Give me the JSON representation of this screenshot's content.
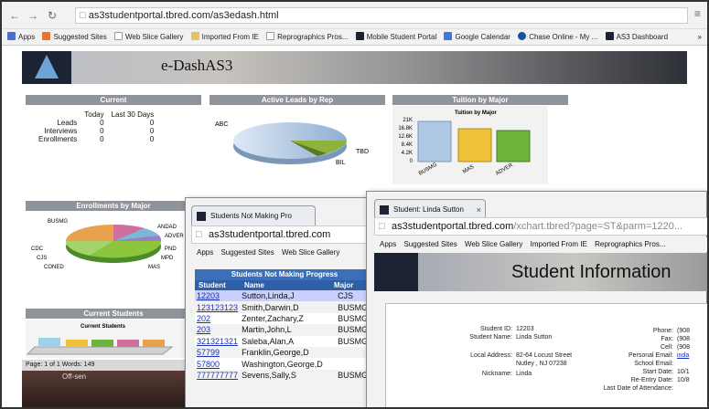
{
  "browser": {
    "url": "as3studentportal.tbred.com/as3edash.html",
    "bookmarks": [
      "Apps",
      "Suggested Sites",
      "Web Slice Gallery",
      "Imported From IE",
      "Reprographics Pros...",
      "Mobile Student Portal",
      "Google Calendar",
      "Chase Online - My ...",
      "AS3 Dashboard"
    ]
  },
  "dashboard": {
    "title": "e-DashAS3",
    "current": {
      "heading": "Current",
      "col_today": "Today",
      "col_30": "Last 30 Days",
      "rows": [
        {
          "label": "Leads",
          "today": "0",
          "last30": "0"
        },
        {
          "label": "Interviews",
          "today": "0",
          "last30": "0"
        },
        {
          "label": "Enrollments",
          "today": "0",
          "last30": "0"
        }
      ]
    },
    "active_leads": {
      "heading": "Active Leads by Rep",
      "labels": [
        "ABC",
        "TBD",
        "BIL"
      ]
    },
    "tuition": {
      "heading": "Tuition by Major",
      "chart_title": "Tuition by Major",
      "yticks": [
        "21K",
        "16.8K",
        "12.6K",
        "8.4K",
        "4.2K",
        "0"
      ],
      "categories": [
        "BUSMG",
        "MAS",
        "ADVER"
      ]
    },
    "enrollments": {
      "heading": "Enrollments by Major",
      "labels": [
        "BUSMG",
        "ANDAD",
        "ADVER",
        "PND",
        "MPD",
        "MAS",
        "CONED",
        "CJS",
        "CDC"
      ]
    },
    "current_students": {
      "heading": "Current Students",
      "chart_title": "Current Students"
    },
    "status_bar": "Page: 1 of 1     Words: 149",
    "underlay_text": "Off-sen"
  },
  "window1": {
    "tab": "Students Not Making Pro",
    "url": "as3studentportal.tbred.com",
    "bookmarks": [
      "Apps",
      "Suggested Sites",
      "Web Slice Gallery"
    ],
    "report_title": "Students Not Making Progress",
    "headers": [
      "Student",
      "Name",
      "Major"
    ],
    "rows": [
      {
        "id": "12203",
        "name": "Sutton,Linda,J",
        "major": "CJS"
      },
      {
        "id": "123123123",
        "name": "Smith,Darwin,D",
        "major": "BUSMG"
      },
      {
        "id": "202",
        "name": "Zenter,Zachary,Z",
        "major": "BUSMG"
      },
      {
        "id": "203",
        "name": "Martin,John,L",
        "major": "BUSMG"
      },
      {
        "id": "321321321",
        "name": "Saleba,Alan,A",
        "major": "BUSMG"
      },
      {
        "id": "57799",
        "name": "Franklin,George,D",
        "major": ""
      },
      {
        "id": "57800",
        "name": "Washington,George,D",
        "major": ""
      },
      {
        "id": "777777777",
        "name": "Sevens,Sally,S",
        "major": "BUSMG"
      }
    ]
  },
  "window2": {
    "tab": "Student: Linda Sutton",
    "url_main": "as3studentportal.tbred.com",
    "url_rest": "/xchart.tbred?page=ST&parm=1220...",
    "bookmarks": [
      "Apps",
      "Suggested Sites",
      "Web Slice Gallery",
      "Imported From IE",
      "Reprographics Pros..."
    ],
    "title": "Student Information",
    "fields": {
      "student_id_label": "Student ID:",
      "student_id": "12203",
      "student_name_label": "Student Name:",
      "student_name": "Linda Sutton",
      "local_address_label": "Local Address:",
      "address1": "82-64 Locust Street",
      "address2": "Nutley , NJ    07238",
      "nickname_label": "Nickname:",
      "nickname": "Linda"
    },
    "right_fields": [
      {
        "label": "Phone:",
        "value": "(908"
      },
      {
        "label": "Fax:",
        "value": "(908"
      },
      {
        "label": "Cell:",
        "value": "(908"
      },
      {
        "label": "Personal Email:",
        "value": "inda"
      },
      {
        "label": "School Email:",
        "value": ""
      },
      {
        "label": "Start Date:",
        "value": "10/1"
      },
      {
        "label": "Re-Entry Date:",
        "value": "10/8"
      },
      {
        "label": "Last Date of Attendance:",
        "value": ""
      }
    ]
  },
  "colors": {
    "panel_header": "#8f949a",
    "link": "#1a2fb0",
    "selected_row": "#c9d0ff",
    "table_header": "#2f5fa8"
  }
}
